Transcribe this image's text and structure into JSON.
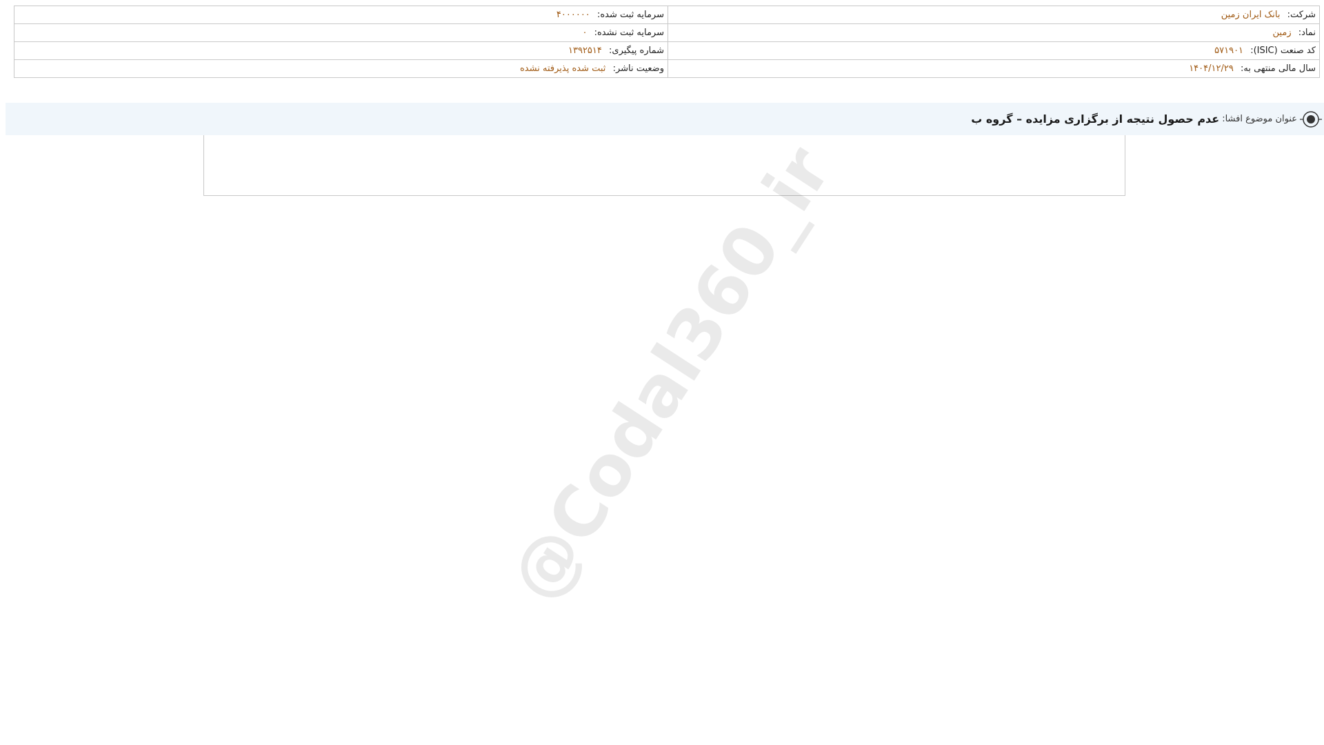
{
  "company_info": {
    "company_label": "شرکت:",
    "company_value": "بانک ایران زمین",
    "symbol_label": "نماد:",
    "symbol_value": "زمین",
    "isic_label": "کد صنعت (ISIC):",
    "isic_value": "۵۷۱۹۰۱",
    "fiscal_year_label": "سال مالی منتهی به:",
    "fiscal_year_value": "۱۴۰۴/۱۲/۲۹",
    "registered_capital_label": "سرمایه ثبت شده:",
    "registered_capital_value": "۴۰۰۰۰۰۰",
    "unregistered_capital_label": "سرمایه ثبت نشده:",
    "unregistered_capital_value": "۰",
    "tracking_number_label": "شماره پیگیری:",
    "tracking_number_value": "۱۳۹۲۵۱۴",
    "publisher_status_label": "وضعیت ناشر:",
    "publisher_status_value": "ثبت شده پذیرفته نشده"
  },
  "disclosure": {
    "title_label": "عنوان موضوع افشا:",
    "title_value": "عدم حصول نتیجه از برگزاری مزایده – گروه ب"
  },
  "watermark": "@Codal360_ir",
  "colors": {
    "value_text": "#a05a14",
    "title_bar_bg": "#f0f6fb",
    "border": "#c8c8c8"
  }
}
